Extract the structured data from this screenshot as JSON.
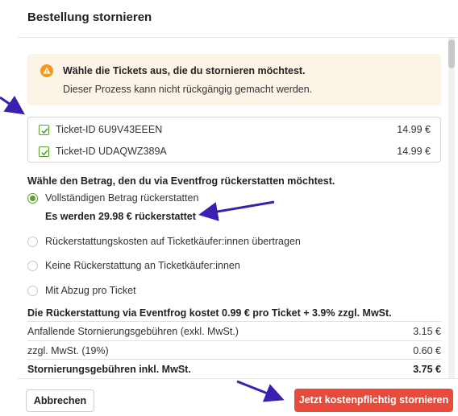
{
  "dialog": {
    "title": "Bestellung stornieren"
  },
  "warning": {
    "title": "Wähle die Tickets aus, die du stornieren möchtest.",
    "text": "Dieser Prozess kann nicht rückgängig gemacht werden.",
    "icon": "warning-icon"
  },
  "tickets": [
    {
      "label": "Ticket-ID 6U9V43EEEN",
      "price": "14.99 €",
      "checked": true
    },
    {
      "label": "Ticket-ID UDAQWZ389A",
      "price": "14.99 €",
      "checked": true
    }
  ],
  "refund": {
    "heading": "Wähle den Betrag, den du via Eventfrog rückerstatten möchtest.",
    "options": [
      {
        "label": "Vollständigen Betrag rückerstatten",
        "selected": true
      },
      {
        "label": "Rückerstattungskosten auf Ticketkäufer:innen übertragen",
        "selected": false
      },
      {
        "label": "Keine Rückerstattung an Ticketkäufer:innen",
        "selected": false
      },
      {
        "label": "Mit Abzug pro Ticket",
        "selected": false
      }
    ],
    "summary": "Es werden 29.98 € rückerstattet"
  },
  "fees": {
    "heading": "Die Rückerstattung via Eventfrog kostet 0.99 € pro Ticket + 3.9% zzgl. MwSt.",
    "rows": [
      {
        "label": "Anfallende Stornierungsgebühren (exkl. MwSt.)",
        "value": "3.15 €"
      },
      {
        "label": "zzgl. MwSt. (19%)",
        "value": "0.60 €"
      },
      {
        "label": "Stornierungsgebühren inkl. MwSt.",
        "value": "3.75 €"
      }
    ]
  },
  "footer": {
    "cancel_label": "Abbrechen",
    "confirm_label": "Jetzt kostenpflichtig stornieren"
  },
  "colors": {
    "accent_green": "#5aa02c",
    "confirm_red": "#e84b3c",
    "warning_bg": "#fdf4e8",
    "warning_icon": "#f29a1c",
    "annotation_arrow": "#3a1fb0"
  }
}
